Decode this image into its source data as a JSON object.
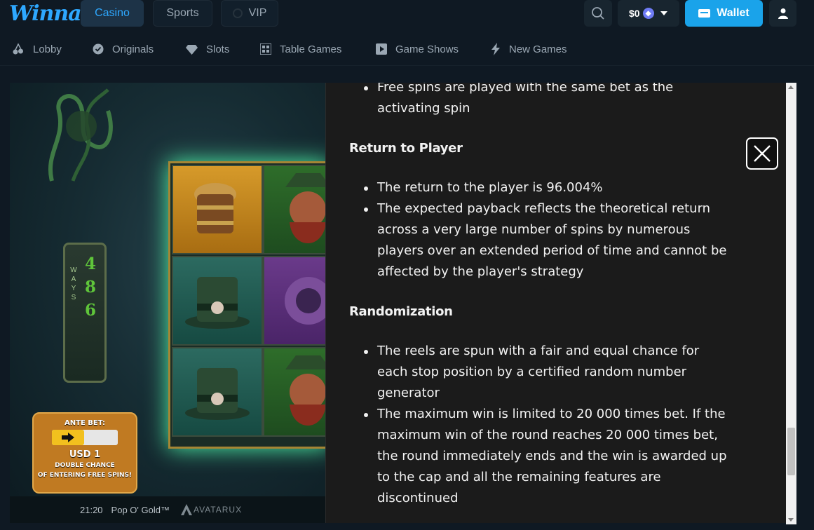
{
  "header": {
    "logo": "Winna",
    "tabs": [
      "Casino",
      "Sports",
      "VIP"
    ],
    "balance": "$0",
    "wallet_label": "Wallet",
    "accent_color": "#1aa3ea"
  },
  "categories": [
    {
      "label": "Lobby",
      "icon": "cherry-icon"
    },
    {
      "label": "Originals",
      "icon": "badge-check-icon"
    },
    {
      "label": "Slots",
      "icon": "gem-icon"
    },
    {
      "label": "Table Games",
      "icon": "grid-icon"
    },
    {
      "label": "Game Shows",
      "icon": "play-icon"
    },
    {
      "label": "New Games",
      "icon": "lightning-icon"
    }
  ],
  "game": {
    "ways_label": "WAYS",
    "ways_values": [
      "4",
      "8",
      "6"
    ],
    "ante": {
      "title": "ANTE BET:",
      "amount": "USD 1",
      "line1": "DOUBLE CHANCE",
      "line2": "OF ENTERING FREE SPINS!"
    },
    "footer": {
      "time": "21:20",
      "title": "Pop O' Gold™",
      "provider": "AVATARUX"
    }
  },
  "paytable": {
    "top_bullet": "Free spins are played with the same bet as the activating spin",
    "rtp_heading": "Return to Player",
    "rtp_items": [
      "The return to the player is 96.004%",
      "The expected payback reflects the theoretical return across a very large number of spins by numerous players over an extended period of time and cannot be affected by the player's strategy"
    ],
    "random_heading": "Randomization",
    "random_items": [
      "The reels are spun with a fair and equal chance for each stop position by a certified random number generator",
      "The maximum win is limited to 20 000 times bet. If the maximum win of the round reaches 20 000 times bet, the round immediately ends and the win is awarded up to the cap and all the remaining features are discontinued"
    ]
  }
}
